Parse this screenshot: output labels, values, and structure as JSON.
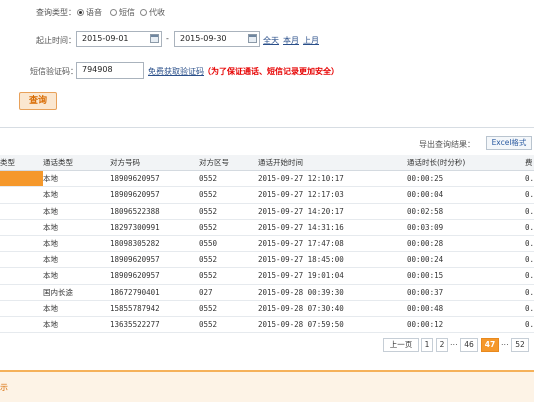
{
  "query_type": {
    "label": "查询类型：",
    "options": [
      {
        "label": "语音",
        "selected": true
      },
      {
        "label": "短信",
        "selected": false
      },
      {
        "label": "代收",
        "selected": false
      }
    ]
  },
  "time_range": {
    "label": "起止时间：",
    "start": "2015-09-01",
    "separator": "-",
    "end": "2015-09-30",
    "links": [
      "全天",
      "本月",
      "上月"
    ]
  },
  "sms_code": {
    "label": "短信验证码：",
    "value": "794908",
    "get_link": "免费获取验证码",
    "notice": "（为了保证通话、短信记录更加安全）"
  },
  "query_button": "查询",
  "export": {
    "label": "导出查询结果：",
    "button": "Excel格式"
  },
  "table": {
    "headers": [
      "类型",
      "通话类型",
      "对方号码",
      "对方区号",
      "通话开始时间",
      "通话时长(时分秒)",
      "费"
    ],
    "rows": [
      [
        "",
        "本地",
        "18909620957",
        "0552",
        "2015-09-27 12:10:17",
        "00:00:25",
        "0."
      ],
      [
        "",
        "本地",
        "18909620957",
        "0552",
        "2015-09-27 12:17:03",
        "00:00:04",
        "0."
      ],
      [
        "",
        "本地",
        "18096522388",
        "0552",
        "2015-09-27 14:20:17",
        "00:02:58",
        "0."
      ],
      [
        "",
        "本地",
        "18297300991",
        "0552",
        "2015-09-27 14:31:16",
        "00:03:09",
        "0."
      ],
      [
        "",
        "本地",
        "18098305282",
        "0550",
        "2015-09-27 17:47:08",
        "00:00:28",
        "0."
      ],
      [
        "",
        "本地",
        "18909620957",
        "0552",
        "2015-09-27 18:45:00",
        "00:00:24",
        "0."
      ],
      [
        "",
        "本地",
        "18909620957",
        "0552",
        "2015-09-27 19:01:04",
        "00:00:15",
        "0."
      ],
      [
        "",
        "国内长途",
        "18672790401",
        "027",
        "2015-09-28 00:39:30",
        "00:00:37",
        "0."
      ],
      [
        "",
        "本地",
        "15855787942",
        "0552",
        "2015-09-28 07:30:40",
        "00:00:48",
        "0."
      ],
      [
        "",
        "本地",
        "13635522277",
        "0552",
        "2015-09-28 07:59:50",
        "00:00:12",
        "0."
      ]
    ]
  },
  "pagination": {
    "prev": "上一页",
    "p1": "1",
    "p2": "2",
    "ellipsis": "...",
    "p46": "46",
    "current": "47",
    "ellipsis2": "...",
    "last": "52",
    "current_value": 47,
    "total_pages": 52
  },
  "bottom_partial": "示",
  "colors": {
    "accent": "#f5982b",
    "link": "#2a4f8a",
    "notice": "#e60000"
  }
}
